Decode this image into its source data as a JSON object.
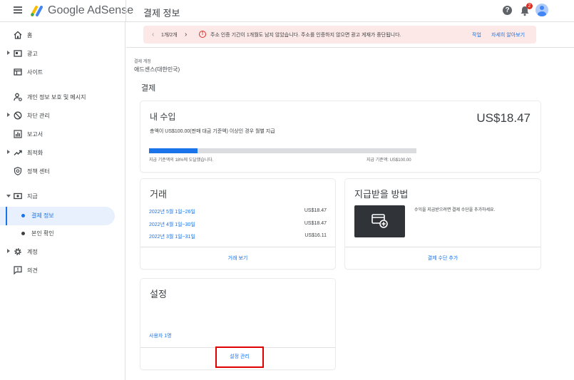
{
  "header": {
    "brand": "Google AdSense",
    "page_title": "결제 정보",
    "help_icon": "help-icon",
    "notifications_count": "2"
  },
  "sidebar": {
    "items": [
      {
        "label": "홈",
        "icon": "home-icon"
      },
      {
        "label": "광고",
        "icon": "ads-icon"
      },
      {
        "label": "사이트",
        "icon": "sites-icon"
      },
      {
        "label": "개인 정보 보호 및 메시지",
        "icon": "privacy-icon"
      },
      {
        "label": "차단 관리",
        "icon": "block-icon"
      },
      {
        "label": "보고서",
        "icon": "reports-icon"
      },
      {
        "label": "최적화",
        "icon": "trending-icon"
      },
      {
        "label": "정책 센터",
        "icon": "policy-icon"
      },
      {
        "label": "지급",
        "icon": "payments-icon"
      },
      {
        "label": "결제 정보"
      },
      {
        "label": "본인 확인"
      },
      {
        "label": "계정",
        "icon": "gear-icon"
      },
      {
        "label": "의견",
        "icon": "feedback-icon"
      }
    ]
  },
  "alert": {
    "pager": "1개/2개",
    "message": "주소 인증 기간이 1개월도 남지 않았습니다. 주소를 인증하지 않으면 광고 게재가 중단됩니다.",
    "action": "작업",
    "learn_more": "자세히 알아보기"
  },
  "account": {
    "label": "결제 계정",
    "name": "애드센스(대한민국)"
  },
  "section_title": "결제",
  "earnings": {
    "title": "내 수입",
    "amount": "US$18.47",
    "description": "총액이 US$100.00(판매 대금 기준액) 이상인 경우 월별 지급",
    "progress": 0.18,
    "progress_text": "지급 기준액의 18%에 도달했습니다.",
    "threshold_text": "지급 기준액: US$100.00"
  },
  "transactions": {
    "title": "거래",
    "rows": [
      {
        "date": "2022년 5월 1일~26일",
        "amount": "US$18.47"
      },
      {
        "date": "2022년 4월 1일~30일",
        "amount": "US$18.47"
      },
      {
        "date": "2022년 3월 1일~31일",
        "amount": "US$16.11"
      }
    ],
    "view_link": "거래 보기"
  },
  "payment_method": {
    "title": "지급받을 방법",
    "hint": "수익을 지급받으려면 결제 수단을 추가하세요.",
    "add_link": "결제 수단 추가"
  },
  "settings": {
    "title": "설정",
    "users": "사용자 1명",
    "manage": "설정 관리"
  }
}
